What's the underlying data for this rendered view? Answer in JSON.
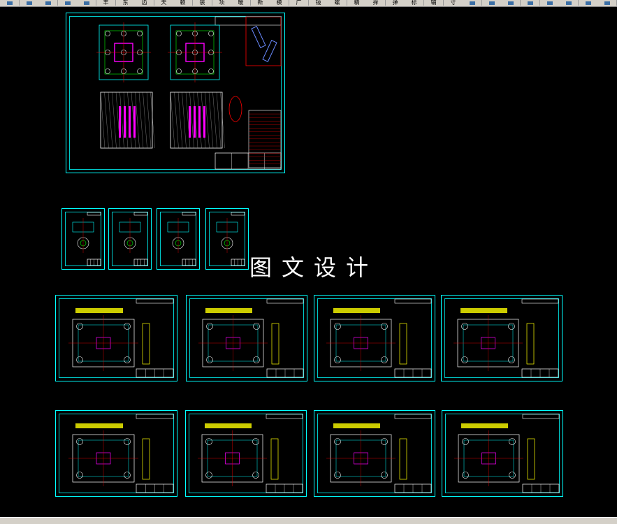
{
  "toolbar": {
    "buttons": [
      {
        "label": "",
        "icon": "app-icon"
      },
      {
        "label": "",
        "icon": "help-icon"
      },
      {
        "label": "",
        "icon": "ruler-icon"
      },
      {
        "label": "",
        "icon": "pencil-icon"
      },
      {
        "label": "",
        "icon": "layer-icon"
      },
      {
        "label": "丰",
        "icon": ""
      },
      {
        "label": "东",
        "icon": ""
      },
      {
        "label": "齿",
        "icon": ""
      },
      {
        "label": "天",
        "icon": ""
      },
      {
        "label": "赖",
        "icon": ""
      },
      {
        "label": "装",
        "icon": ""
      },
      {
        "label": "项",
        "icon": ""
      },
      {
        "label": "暖",
        "icon": ""
      },
      {
        "label": "新",
        "icon": ""
      },
      {
        "label": "模",
        "icon": ""
      },
      {
        "label": "广",
        "icon": ""
      },
      {
        "label": "镜",
        "icon": ""
      },
      {
        "label": "螺",
        "icon": ""
      },
      {
        "label": "精",
        "icon": ""
      },
      {
        "label": "择",
        "icon": ""
      },
      {
        "label": "弹",
        "icon": ""
      },
      {
        "label": "标",
        "icon": ""
      },
      {
        "label": "辅",
        "icon": ""
      },
      {
        "label": "寸",
        "icon": ""
      },
      {
        "label": "",
        "icon": "grid-icon"
      },
      {
        "label": "",
        "icon": "table-icon"
      },
      {
        "label": "",
        "icon": "dim-icon"
      },
      {
        "label": "",
        "icon": "snap-icon"
      },
      {
        "label": "",
        "icon": "check-icon"
      },
      {
        "label": "",
        "icon": "text-icon"
      },
      {
        "label": "",
        "icon": "chart-icon"
      },
      {
        "label": "",
        "icon": "print-icon"
      }
    ]
  },
  "watermark": "图文设计",
  "colors": {
    "canvas": "#000000",
    "frame": "#00ffff",
    "title_block": "#ffffff",
    "drawing_a": "#00ffff",
    "drawing_b": "#ff00ff",
    "drawing_c": "#ffff00",
    "drawing_d": "#00ff00",
    "accent_red": "#ff0000"
  }
}
